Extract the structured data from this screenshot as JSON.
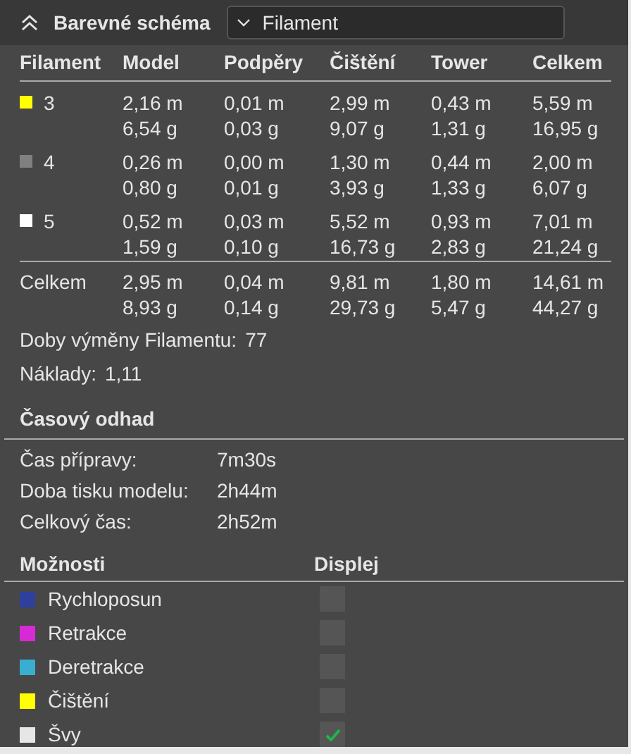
{
  "header": {
    "title": "Barevné schéma",
    "dropdown": "Filament"
  },
  "table": {
    "columns": [
      "Filament",
      "Model",
      "Podpěry",
      "Čištění",
      "Tower",
      "Celkem"
    ],
    "rows": [
      {
        "color": "#ffff00",
        "cells": [
          [
            "3"
          ],
          [
            "2,16 m",
            "6,54 g"
          ],
          [
            "0,01 m",
            "0,03 g"
          ],
          [
            "2,99 m",
            "9,07 g"
          ],
          [
            "0,43 m",
            "1,31 g"
          ],
          [
            "5,59 m",
            "16,95 g"
          ]
        ]
      },
      {
        "color": "#808080",
        "cells": [
          [
            "4"
          ],
          [
            "0,26 m",
            "0,80 g"
          ],
          [
            "0,00 m",
            "0,01 g"
          ],
          [
            "1,30 m",
            "3,93 g"
          ],
          [
            "0,44 m",
            "1,33 g"
          ],
          [
            "2,00 m",
            "6,07 g"
          ]
        ]
      },
      {
        "color": "#ffffff",
        "cells": [
          [
            "5"
          ],
          [
            "0,52 m",
            "1,59 g"
          ],
          [
            "0,03 m",
            "0,10 g"
          ],
          [
            "5,52 m",
            "16,73 g"
          ],
          [
            "0,93 m",
            "2,83 g"
          ],
          [
            "7,01 m",
            "21,24 g"
          ]
        ]
      }
    ],
    "total": {
      "cells": [
        [
          "Celkem"
        ],
        [
          "2,95 m",
          "8,93 g"
        ],
        [
          "0,04 m",
          "0,14 g"
        ],
        [
          "9,81 m",
          "29,73 g"
        ],
        [
          "1,80 m",
          "5,47 g"
        ],
        [
          "14,61 m",
          "44,27 g"
        ]
      ]
    }
  },
  "stats": [
    {
      "label": "Doby výměny Filamentu:",
      "value": "77"
    },
    {
      "label": "Náklady:",
      "value": "1,11"
    }
  ],
  "time": {
    "title": "Časový odhad",
    "rows": [
      {
        "label": "Čas přípravy:",
        "value": "7m30s"
      },
      {
        "label": "Doba tisku modelu:",
        "value": "2h44m"
      },
      {
        "label": "Celkový čas:",
        "value": "2h52m"
      }
    ]
  },
  "options": {
    "columns": [
      "Možnosti",
      "Displej"
    ],
    "items": [
      {
        "label": "Rychloposun",
        "color": "#2e3f9e",
        "checked": false
      },
      {
        "label": "Retrakce",
        "color": "#d62ad6",
        "checked": false
      },
      {
        "label": "Deretrakce",
        "color": "#3aaed0",
        "checked": false
      },
      {
        "label": "Čištění",
        "color": "#ffff00",
        "checked": false
      },
      {
        "label": "Švy",
        "color": "#e6e6e6",
        "checked": true
      }
    ]
  }
}
